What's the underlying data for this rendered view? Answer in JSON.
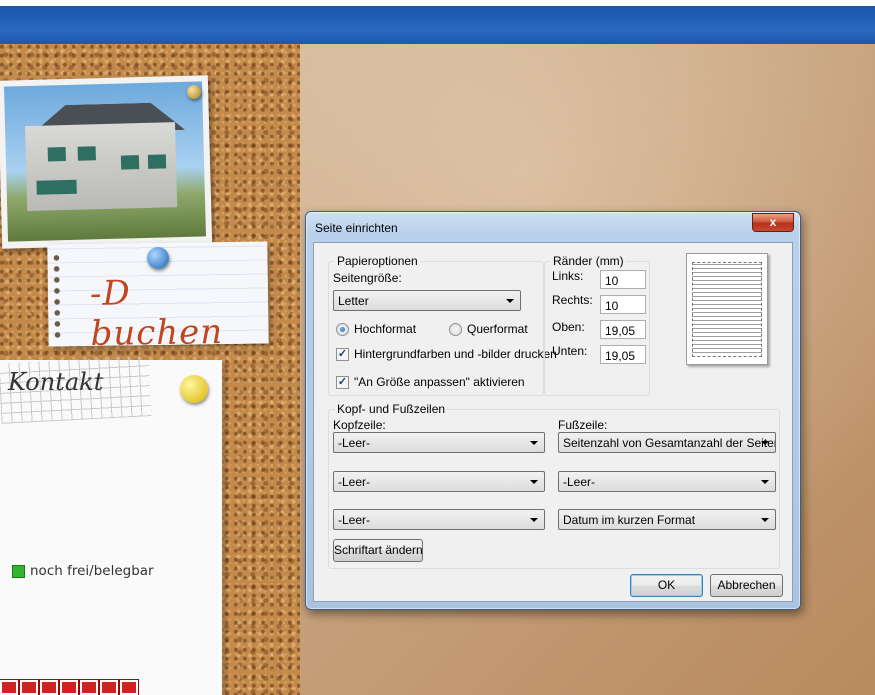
{
  "background": {
    "note_buchen": "-D buchen",
    "note_kontakt": "Kontakt",
    "legend_label": "noch frei/belegbar",
    "legend_color": "#2fb52f"
  },
  "dialog": {
    "title": "Seite einrichten",
    "close_label": "x",
    "paper": {
      "legend": "Papieroptionen",
      "size_label": "Seitengröße:",
      "size_value": "Letter",
      "portrait_label": "Hochformat",
      "landscape_label": "Querformat",
      "orientation_selected": "Hochformat",
      "print_background_label": "Hintergrundfarben und -bilder drucken",
      "print_background_checked": true,
      "shrink_to_fit_label": "\"An Größe anpassen\" aktivieren",
      "shrink_to_fit_checked": true
    },
    "margins": {
      "legend": "Ränder (mm)",
      "left_label": "Links:",
      "left_value": "10",
      "right_label": "Rechts:",
      "right_value": "10",
      "top_label": "Oben:",
      "top_value": "19,05",
      "bottom_label": "Unten:",
      "bottom_value": "19,05"
    },
    "headers_footers": {
      "legend": "Kopf- und Fußzeilen",
      "header_label": "Kopfzeile:",
      "footer_label": "Fußzeile:",
      "header_1": "-Leer-",
      "header_2": "-Leer-",
      "header_3": "-Leer-",
      "footer_1": "Seitenzahl von Gesamtanzahl der Seiten",
      "footer_2": "-Leer-",
      "footer_3": "Datum im kurzen Format",
      "font_button": "Schriftart ändern"
    },
    "ok_label": "OK",
    "cancel_label": "Abbrechen"
  }
}
